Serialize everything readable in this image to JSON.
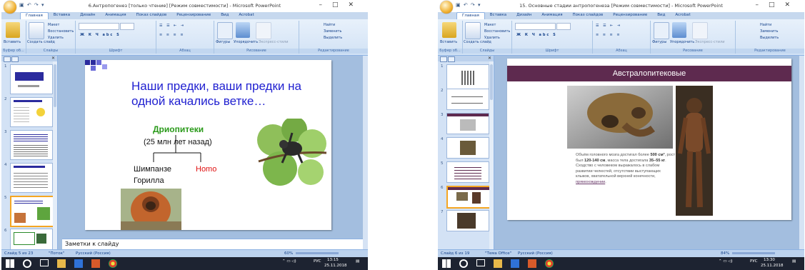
{
  "left_window": {
    "title": "6.Антропогенез [только чтение] [Режим совместимости] - Microsoft PowerPoint",
    "tabs": [
      "Главная",
      "Вставка",
      "Дизайн",
      "Анимация",
      "Показ слайдов",
      "Рецензирование",
      "Вид",
      "Acrobat"
    ],
    "ribbon": {
      "paste": "Вставить",
      "clipboard": "Буфер об...",
      "new_slide": "Создать слайд",
      "layout": "Макет",
      "reset": "Восстановить",
      "delete": "Удалить",
      "slides": "Слайды",
      "font": "Шрифт",
      "paragraph": "Абзац",
      "shapes": "Фигуры",
      "arrange": "Упорядочить",
      "quick_styles": "Экспресс-стили",
      "drawing": "Рисование",
      "find": "Найти",
      "replace": "Заменить",
      "select": "Выделить",
      "editing": "Редактирование"
    },
    "slide_numbers": [
      "1",
      "2",
      "3",
      "4",
      "5",
      "6"
    ],
    "slide": {
      "title": "Наши предки, ваши предки на одной качались ветке…",
      "dryopithecus": "Дриопитеки",
      "years": "(25 млн лет назад)",
      "chimp": "Шимпанзе",
      "homo": "Homo",
      "gorilla": "Горилла"
    },
    "notes": "Заметки к слайду",
    "status": {
      "slide": "Слайд 5 из 23",
      "theme": "\"Поток\"",
      "lang": "Русский (Россия)",
      "zoom": "60%"
    },
    "taskbar": {
      "lang": "РУС",
      "time": "13:15",
      "date": "25.11.2018"
    }
  },
  "right_window": {
    "title": "15. Основные стадии антропогенеза [Режим совместимости] - Microsoft PowerPoint",
    "tabs": [
      "Главная",
      "Вставка",
      "Дизайн",
      "Анимация",
      "Показ слайдов",
      "Рецензирование",
      "Вид",
      "Acrobat"
    ],
    "ribbon": {
      "paste": "Вставить",
      "clipboard": "Буфер об...",
      "new_slide": "Создать слайд",
      "layout": "Макет",
      "reset": "Восстановить",
      "delete": "Удалить",
      "slides": "Слайды",
      "font": "Шрифт",
      "paragraph": "Абзац",
      "shapes": "Фигуры",
      "arrange": "Упорядочить",
      "quick_styles": "Экспресс-стили",
      "drawing": "Рисование",
      "find": "Найти",
      "replace": "Заменить",
      "select": "Выделить",
      "editing": "Редактирование"
    },
    "slide_numbers": [
      "1",
      "2",
      "3",
      "4",
      "5",
      "6",
      "7"
    ],
    "slide": {
      "heading": "Австралопитековые",
      "text_parts": {
        "a": "Объём головного мозга достигал более ",
        "b": "500 см³",
        "c": ", рост был ",
        "d": "120-140 см",
        "e": ", масса тела достигала ",
        "f": "35–55 кг",
        "g": ". Сходство с человеком выражалось в слабом развитии челюстей, отсутствии выступающих клыков, хватательной верхней конечности, ",
        "h": "прямохождении",
        "i": "."
      }
    },
    "status": {
      "slide": "Слайд 6 из 19",
      "theme": "\"Тема Office\"",
      "lang": "Русский (Россия)",
      "zoom": "84%"
    },
    "taskbar": {
      "lang": "РУС",
      "time": "13:30",
      "date": "25.11.2018"
    }
  }
}
